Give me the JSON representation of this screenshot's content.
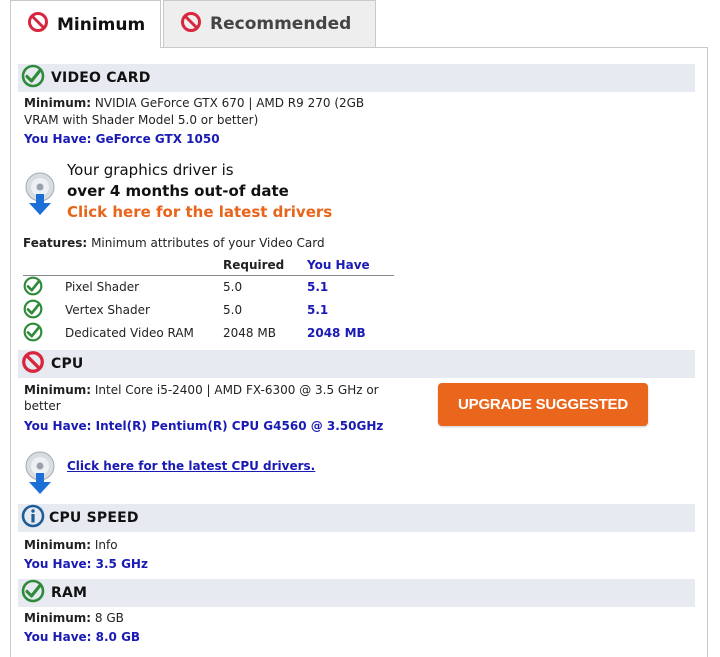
{
  "tabs": [
    {
      "label": "Minimum",
      "active": true
    },
    {
      "label": "Recommended",
      "active": false
    }
  ],
  "colors": {
    "accent_blue": "#1a1ab5",
    "orange": "#e9661c",
    "check_green": "#2e8b3a",
    "ban_red": "#d7263d",
    "info_blue": "#1f5d99",
    "header_bg": "#e7ebf1"
  },
  "video_card": {
    "title": "VIDEO CARD",
    "status_icon": "check-icon",
    "minimum_label": "Minimum:",
    "minimum_line1": "NVIDIA GeForce GTX 670 | AMD R9 270 (2GB",
    "minimum_line2": "VRAM with Shader Model 5.0 or better)",
    "you_have": "You Have: GeForce GTX 1050",
    "driver_line1": "Your graphics driver is",
    "driver_line2": "over 4 months out-of date",
    "driver_link": "Click here for the latest drivers",
    "features_label": "Features:",
    "features_text": "Minimum attributes of your Video Card",
    "features_header": {
      "required": "Required",
      "you_have": "You Have"
    },
    "features": [
      {
        "name": "Pixel Shader",
        "required": "5.0",
        "have": "5.1"
      },
      {
        "name": "Vertex Shader",
        "required": "5.0",
        "have": "5.1"
      },
      {
        "name": "Dedicated Video RAM",
        "required": "2048 MB",
        "have": "2048 MB"
      }
    ]
  },
  "cpu": {
    "title": "CPU",
    "status_icon": "ban-icon",
    "minimum_label": "Minimum:",
    "minimum_line1": "Intel Core i5-2400 | AMD FX-6300 @ 3.5 GHz or",
    "minimum_line2": "better",
    "you_have": "You Have: Intel(R) Pentium(R) CPU G4560 @ 3.50GHz",
    "upgrade": "UPGRADE SUGGESTED",
    "driver_link": "Click here for the latest CPU drivers."
  },
  "cpu_speed": {
    "title": "CPU SPEED",
    "status_icon": "info-icon",
    "minimum_label": "Minimum:",
    "minimum_value": "Info",
    "you_have": "You Have: 3.5 GHz"
  },
  "ram": {
    "title": "RAM",
    "status_icon": "check-icon",
    "minimum_label": "Minimum:",
    "minimum_value": "8 GB",
    "you_have": "You Have: 8.0 GB"
  }
}
